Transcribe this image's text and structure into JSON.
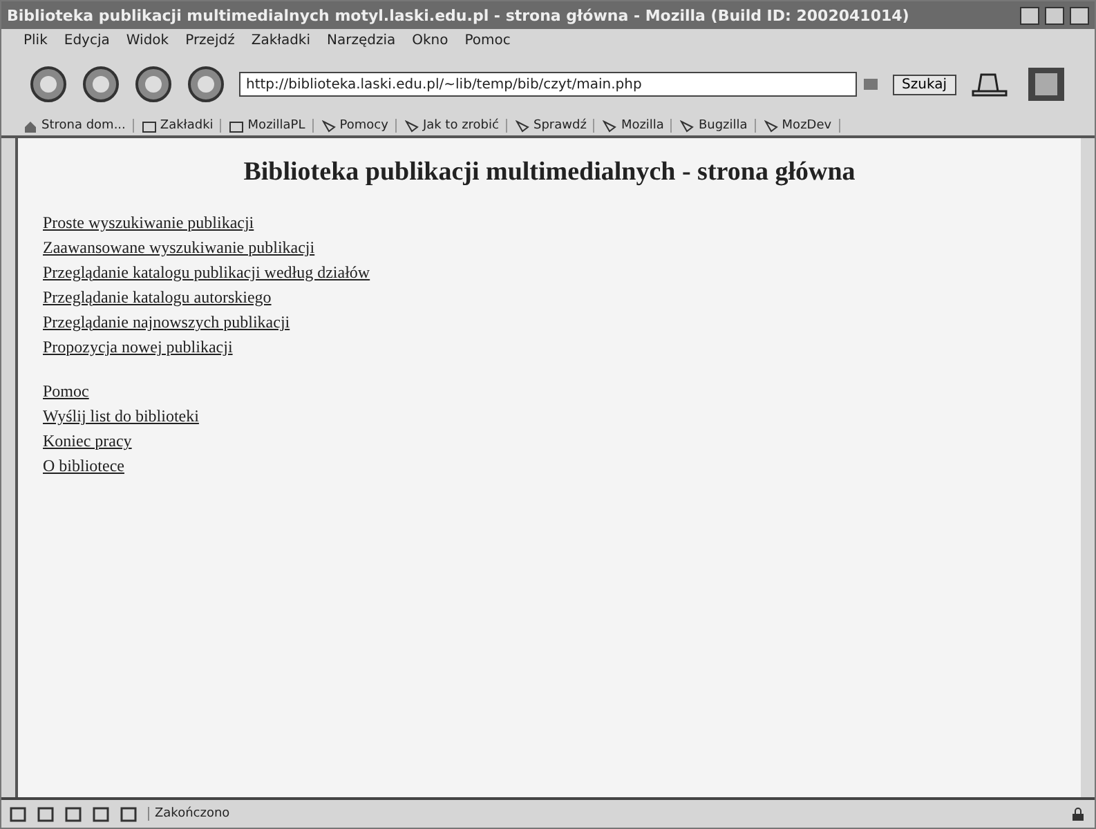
{
  "window": {
    "title": "Biblioteka publikacji multimedialnych motyl.laski.edu.pl - strona główna - Mozilla (Build ID: 2002041014)"
  },
  "menu": [
    "Plik",
    "Edycja",
    "Widok",
    "Przejdź",
    "Zakładki",
    "Narzędzia",
    "Okno",
    "Pomoc"
  ],
  "address": {
    "value": "http://biblioteka.laski.edu.pl/~lib/temp/bib/czyt/main.php"
  },
  "search_button": "Szukaj",
  "bookmarks": [
    {
      "label": "Strona dom...",
      "kind": "home"
    },
    {
      "label": "Zakładki",
      "kind": "folder"
    },
    {
      "label": "MozillaPL",
      "kind": "folder"
    },
    {
      "label": "Pomocy",
      "kind": "link"
    },
    {
      "label": "Jak to zrobić",
      "kind": "link"
    },
    {
      "label": "Sprawdź",
      "kind": "link"
    },
    {
      "label": "Mozilla",
      "kind": "link"
    },
    {
      "label": "Bugzilla",
      "kind": "link"
    },
    {
      "label": "MozDev",
      "kind": "link"
    }
  ],
  "page": {
    "heading": "Biblioteka publikacji multimedialnych - strona główna",
    "link_groups": [
      [
        "Proste wyszukiwanie publikacji",
        "Zaawansowane wyszukiwanie publikacji",
        "Przeglądanie katalogu publikacji według działów",
        "Przeglądanie katalogu autorskiego",
        "Przeglądanie najnowszych publikacji",
        "Propozycja nowej publikacji"
      ],
      [
        "Pomoc",
        "Wyślij list do biblioteki",
        "Koniec pracy",
        "O bibliotece"
      ]
    ]
  },
  "status_bar": {
    "text": "Zakończono"
  }
}
